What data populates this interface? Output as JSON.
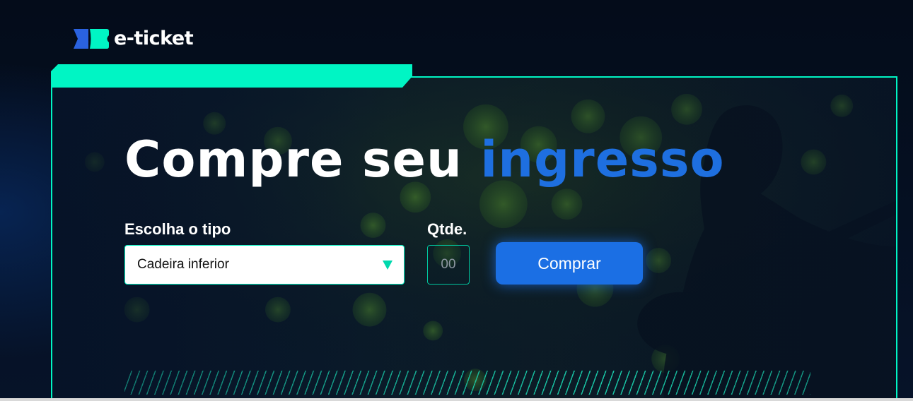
{
  "brand": {
    "name": "e-ticket",
    "accent_color": "#00f5c4",
    "primary_color": "#1b6fe4"
  },
  "hero": {
    "title_main": "Compre seu",
    "title_accent": "ingresso",
    "background_image": "guitarist-on-stage-with-green-bokeh-lights"
  },
  "form": {
    "type_label": "Escolha o tipo",
    "type_selected": "Cadeira inferior",
    "qty_label": "Qtde.",
    "qty_placeholder": "00",
    "submit_label": "Comprar"
  },
  "icons": {
    "logo": "ticket-icon",
    "dropdown": "triangle-down-icon"
  }
}
